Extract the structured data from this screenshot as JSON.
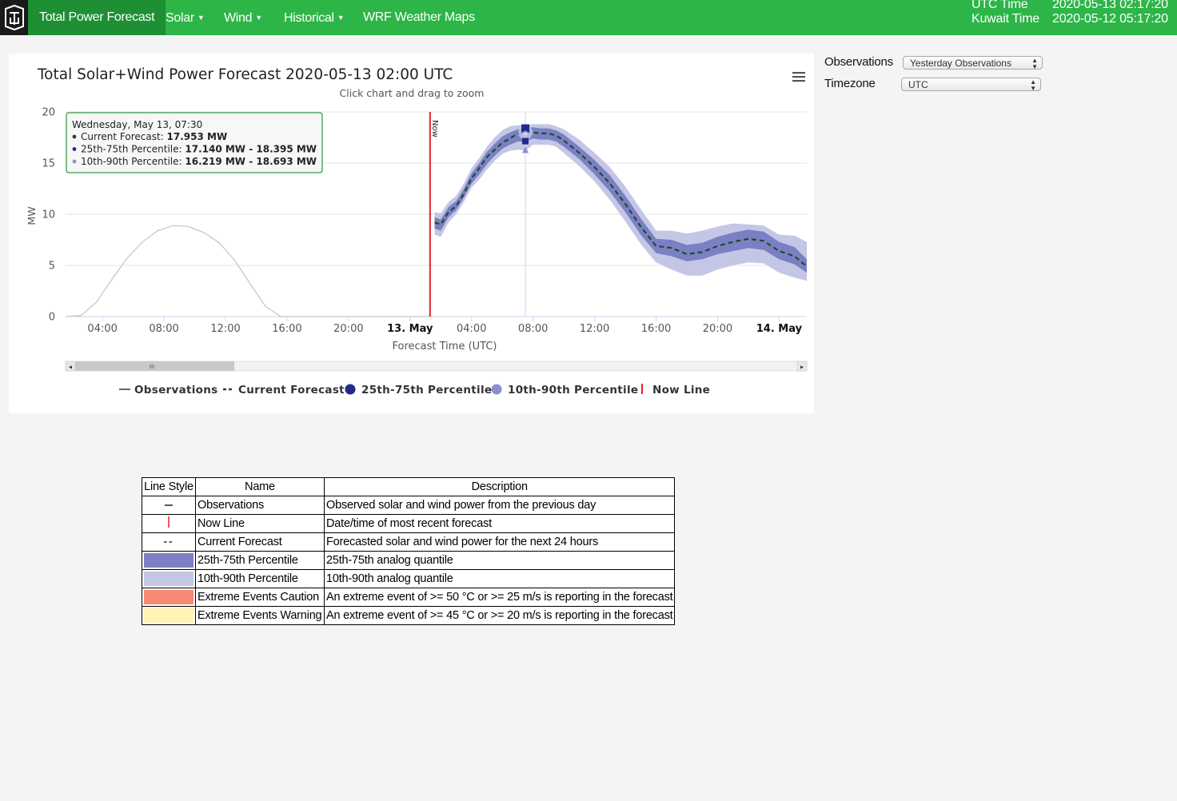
{
  "navbar": {
    "brand_icon": "logo-icon",
    "items": [
      {
        "label": "Total Power Forecast",
        "active": true
      },
      {
        "label": "Solar",
        "dropdown": true
      },
      {
        "label": "Wind",
        "dropdown": true
      },
      {
        "label": "Historical",
        "dropdown": true
      },
      {
        "label": "WRF Weather Maps"
      }
    ],
    "utc_label": "UTC Time",
    "utc_value": "2020-05-13 02:17:20",
    "kuwait_label": "Kuwait Time",
    "kuwait_value": "2020-05-12 05:17:20"
  },
  "controls": {
    "observations_label": "Observations",
    "observations_value": "Yesterday Observations",
    "timezone_label": "Timezone",
    "timezone_value": "UTC"
  },
  "chart_data": {
    "type": "line",
    "title": "Total Solar+Wind Power Forecast 2020-05-13 02:00 UTC",
    "subtitle": "Click chart and drag to zoom",
    "xlabel": "Forecast Time (UTC)",
    "ylabel": "MW",
    "ylim": [
      0,
      20
    ],
    "yticks": [
      0,
      5,
      10,
      15,
      20
    ],
    "xlim_hours": [
      1.6,
      49.8
    ],
    "xticks": [
      {
        "h": 4,
        "label": "04:00",
        "bold": false
      },
      {
        "h": 8,
        "label": "08:00",
        "bold": false
      },
      {
        "h": 12,
        "label": "12:00",
        "bold": false
      },
      {
        "h": 16,
        "label": "16:00",
        "bold": false
      },
      {
        "h": 20,
        "label": "20:00",
        "bold": false
      },
      {
        "h": 24,
        "label": "13. May",
        "bold": true
      },
      {
        "h": 28,
        "label": "04:00",
        "bold": false
      },
      {
        "h": 32,
        "label": "08:00",
        "bold": false
      },
      {
        "h": 36,
        "label": "12:00",
        "bold": false
      },
      {
        "h": 40,
        "label": "16:00",
        "bold": false
      },
      {
        "h": 44,
        "label": "20:00",
        "bold": false
      },
      {
        "h": 48,
        "label": "14. May",
        "bold": true
      }
    ],
    "now_hour": 25.3,
    "now_label": "Now",
    "hover_hour": 31.5,
    "colors": {
      "observations": "#c8c8c8",
      "forecast": "#1b4d2e",
      "p25_75": "#7b80c4",
      "p10_90": "#c4c6e6",
      "now": "#e8212a"
    },
    "series": [
      {
        "name": "Observations",
        "x": [
          1.6,
          2.6,
          3.6,
          4.6,
          5.6,
          6.6,
          7.6,
          8.6,
          9.6,
          10.6,
          11.6,
          12.6,
          13.6,
          14.6,
          15.6,
          16.6,
          17.6,
          18.6,
          19.6,
          20.6,
          21.6,
          22.6,
          23.6,
          24.6,
          25.3
        ],
        "values": [
          0.0,
          0.1,
          1.4,
          3.6,
          5.7,
          7.3,
          8.4,
          8.9,
          8.8,
          8.2,
          7.2,
          5.5,
          3.2,
          1.0,
          0.0,
          0.0,
          0.0,
          0.0,
          0.0,
          0.0,
          0.0,
          0.0,
          0.0,
          0.0,
          0.0
        ]
      },
      {
        "name": "Current Forecast",
        "x": [
          25.6,
          26.0,
          26.5,
          27.0,
          27.5,
          28.0,
          28.5,
          29.0,
          29.5,
          30.0,
          30.5,
          31.0,
          31.5,
          32.0,
          32.5,
          33.0,
          33.5,
          34.0,
          35.0,
          36.0,
          37.0,
          38.0,
          39.0,
          40.0,
          41.0,
          42.0,
          43.0,
          44.0,
          45.0,
          46.0,
          47.0,
          48.0,
          49.0,
          49.8
        ],
        "values": [
          9.2,
          9.0,
          10.2,
          10.8,
          12.0,
          13.5,
          14.5,
          15.6,
          16.3,
          17.0,
          17.4,
          17.9,
          17.95,
          18.0,
          17.9,
          17.9,
          17.7,
          17.2,
          16.0,
          14.6,
          13.0,
          11.0,
          8.8,
          6.9,
          6.7,
          6.1,
          6.3,
          6.9,
          7.3,
          7.6,
          7.4,
          6.4,
          5.9,
          4.9
        ]
      },
      {
        "name": "25th-75th Percentile",
        "x": [
          25.6,
          26.0,
          26.5,
          27.0,
          27.5,
          28.0,
          28.5,
          29.0,
          29.5,
          30.0,
          30.5,
          31.0,
          31.5,
          32.0,
          32.5,
          33.0,
          33.5,
          34.0,
          35.0,
          36.0,
          37.0,
          38.0,
          39.0,
          40.0,
          41.0,
          42.0,
          43.0,
          44.0,
          45.0,
          46.0,
          47.0,
          48.0,
          49.0,
          49.8
        ],
        "low": [
          8.6,
          8.4,
          9.7,
          10.4,
          11.6,
          13.0,
          13.9,
          14.9,
          15.7,
          16.4,
          16.8,
          17.1,
          17.14,
          17.4,
          17.3,
          17.3,
          17.1,
          16.6,
          15.4,
          13.9,
          12.2,
          10.2,
          8.0,
          6.2,
          5.9,
          5.4,
          5.6,
          6.1,
          6.4,
          6.7,
          6.5,
          5.6,
          5.1,
          4.3
        ],
        "high": [
          9.7,
          9.5,
          10.7,
          11.3,
          12.5,
          14.0,
          15.0,
          16.1,
          16.9,
          17.6,
          18.0,
          18.3,
          18.395,
          18.5,
          18.4,
          18.4,
          18.2,
          17.8,
          16.6,
          15.3,
          13.8,
          11.8,
          9.6,
          7.6,
          7.5,
          7.0,
          7.2,
          7.8,
          8.2,
          8.5,
          8.3,
          7.3,
          6.8,
          5.6
        ]
      },
      {
        "name": "10th-90th Percentile",
        "x": [
          25.6,
          26.0,
          26.5,
          27.0,
          27.5,
          28.0,
          28.5,
          29.0,
          29.5,
          30.0,
          30.5,
          31.0,
          31.5,
          32.0,
          32.5,
          33.0,
          33.5,
          34.0,
          35.0,
          36.0,
          37.0,
          38.0,
          39.0,
          40.0,
          41.0,
          42.0,
          43.0,
          44.0,
          45.0,
          46.0,
          47.0,
          48.0,
          49.0,
          49.8
        ],
        "low": [
          8.0,
          7.8,
          9.2,
          10.0,
          11.2,
          12.6,
          13.4,
          14.4,
          15.2,
          15.9,
          16.2,
          16.3,
          16.219,
          16.8,
          16.8,
          16.8,
          16.6,
          16.0,
          14.7,
          13.2,
          11.4,
          9.3,
          7.1,
          5.3,
          4.6,
          4.0,
          4.0,
          4.6,
          5.0,
          5.3,
          5.2,
          4.3,
          3.8,
          3.5
        ],
        "high": [
          10.2,
          10.1,
          11.2,
          11.8,
          13.0,
          14.5,
          15.5,
          16.6,
          17.5,
          18.2,
          18.6,
          18.7,
          18.693,
          18.8,
          18.8,
          18.8,
          18.6,
          18.3,
          17.3,
          16.0,
          14.6,
          12.7,
          10.5,
          8.4,
          8.4,
          8.1,
          8.4,
          8.8,
          9.1,
          9.0,
          8.9,
          8.0,
          7.9,
          7.3
        ]
      }
    ],
    "tooltip": {
      "header": "Wednesday, May 13, 07:30",
      "rows": [
        {
          "label": "Current Forecast: ",
          "value": "17.953 MW",
          "color": "#1b4d2e"
        },
        {
          "label": "25th-75th Percentile: ",
          "value": "17.140 MW - 18.395 MW",
          "color": "#1f2a8a"
        },
        {
          "label": "10th-90th Percentile: ",
          "value": "16.219 MW - 18.693 MW",
          "color": "#8a8fd0"
        }
      ]
    },
    "legend": [
      {
        "label": "Observations",
        "symbol": "line",
        "color": "#333333"
      },
      {
        "label": "Current Forecast",
        "symbol": "dash",
        "color": "#1b4d2e"
      },
      {
        "label": "25th-75th Percentile",
        "symbol": "dot",
        "color": "#1f2a8a"
      },
      {
        "label": "10th-90th Percentile",
        "symbol": "dot",
        "color": "#8a8fd0"
      },
      {
        "label": "Now Line",
        "symbol": "vline",
        "color": "#e8212a"
      }
    ],
    "scrollbar": {
      "thumb_fraction": 0.22,
      "grip_icon": "grip-icon"
    },
    "menu_icon": "hamburger-menu-icon"
  },
  "legend_table": {
    "headers": [
      "Line Style",
      "Name",
      "Description"
    ],
    "rows": [
      {
        "style": "solid",
        "swatch": "",
        "name": "Observations",
        "description": "Observed solar and wind power from the previous day"
      },
      {
        "style": "red",
        "swatch": "#e8212a",
        "name": "Now Line",
        "description": "Date/time of most recent forecast"
      },
      {
        "style": "dashed",
        "swatch": "",
        "name": "Current Forecast",
        "description": "Forecasted solar and wind power for the next 24 hours"
      },
      {
        "style": "fill",
        "swatch": "#7b80c4",
        "name": "25th-75th Percentile",
        "description": "25th-75th analog quantile"
      },
      {
        "style": "fill",
        "swatch": "#c4c6e6",
        "name": "10th-90th Percentile",
        "description": "10th-90th analog quantile"
      },
      {
        "style": "fill",
        "swatch": "#f78a74",
        "name": "Extreme Events Caution",
        "description": "An extreme event of >= 50 °C or >= 25 m/s is reporting in the forecast"
      },
      {
        "style": "fill",
        "swatch": "#fff3b3",
        "name": "Extreme Events Warning",
        "description": "An extreme event of >= 45 °C or >= 20 m/s is reporting in the forecast"
      }
    ]
  }
}
